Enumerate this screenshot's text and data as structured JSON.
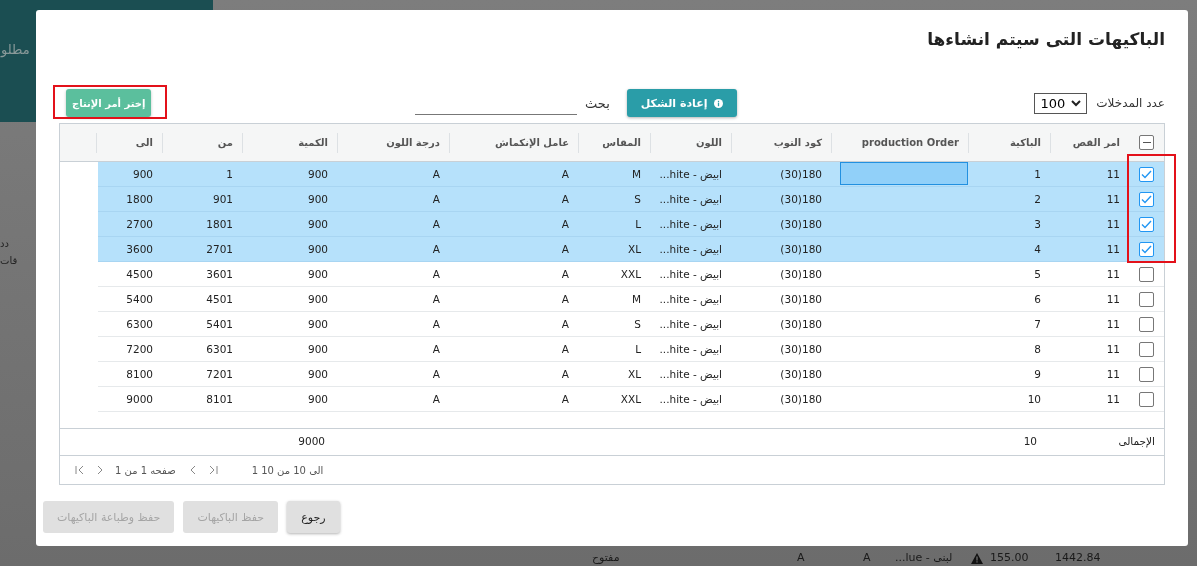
{
  "background": {
    "header_subtitle": "مطلو",
    "side_labels": [
      "دد",
      "قات"
    ],
    "row_cells": [
      "1442.84",
      "155.00",
      "...lue - لبنى",
      "A",
      "A",
      "مفتوح"
    ],
    "row_warning": true
  },
  "dialog": {
    "title": "الباكيهات التى سيتم انشاءها",
    "entries_label": "عدد المدخلات",
    "entries_value": "100",
    "reset_button": "إعادة الشكل",
    "search_label": "بحث",
    "choose_button": "إختر أمر الإنتاج",
    "header_checkbox_partial": true,
    "columns": [
      "امر القص",
      "الباكية",
      "production Order",
      "كود التوب",
      "اللون",
      "المقاس",
      "عامل الإنكماش",
      "درجة اللون",
      "الكمية",
      "من",
      "الى"
    ],
    "rows": [
      {
        "selected": true,
        "editing": true,
        "cells": [
          "11",
          "1",
          "",
          "180(30)",
          "ابيض - hite...",
          "M",
          "A",
          "A",
          "900",
          "1",
          "900"
        ]
      },
      {
        "selected": true,
        "editing": false,
        "cells": [
          "11",
          "2",
          "",
          "180(30)",
          "ابيض - hite...",
          "S",
          "A",
          "A",
          "900",
          "901",
          "1800"
        ]
      },
      {
        "selected": true,
        "editing": false,
        "cells": [
          "11",
          "3",
          "",
          "180(30)",
          "ابيض - hite...",
          "L",
          "A",
          "A",
          "900",
          "1801",
          "2700"
        ]
      },
      {
        "selected": true,
        "editing": false,
        "cells": [
          "11",
          "4",
          "",
          "180(30)",
          "ابيض - hite...",
          "XL",
          "A",
          "A",
          "900",
          "2701",
          "3600"
        ]
      },
      {
        "selected": false,
        "editing": false,
        "cells": [
          "11",
          "5",
          "",
          "180(30)",
          "ابيض - hite...",
          "XXL",
          "A",
          "A",
          "900",
          "3601",
          "4500"
        ]
      },
      {
        "selected": false,
        "editing": false,
        "cells": [
          "11",
          "6",
          "",
          "180(30)",
          "ابيض - hite...",
          "M",
          "A",
          "A",
          "900",
          "4501",
          "5400"
        ]
      },
      {
        "selected": false,
        "editing": false,
        "cells": [
          "11",
          "7",
          "",
          "180(30)",
          "ابيض - hite...",
          "S",
          "A",
          "A",
          "900",
          "5401",
          "6300"
        ]
      },
      {
        "selected": false,
        "editing": false,
        "cells": [
          "11",
          "8",
          "",
          "180(30)",
          "ابيض - hite...",
          "L",
          "A",
          "A",
          "900",
          "6301",
          "7200"
        ]
      },
      {
        "selected": false,
        "editing": false,
        "cells": [
          "11",
          "9",
          "",
          "180(30)",
          "ابيض - hite...",
          "XL",
          "A",
          "A",
          "900",
          "7201",
          "8100"
        ]
      },
      {
        "selected": false,
        "editing": false,
        "cells": [
          "11",
          "10",
          "",
          "180(30)",
          "ابيض - hite...",
          "XXL",
          "A",
          "A",
          "900",
          "8101",
          "9000"
        ]
      }
    ],
    "totals": {
      "label": "الإجمالى",
      "count": "10",
      "quantity": "9000"
    },
    "pager": {
      "range": "1 الى 10 من 10",
      "page": "صفحه 1 من 1"
    },
    "buttons": [
      {
        "label": "رجوع",
        "disabled": false
      },
      {
        "label": "حفظ الباكيهات",
        "disabled": true
      },
      {
        "label": "حفظ وطباعة الباكيهات",
        "disabled": true
      }
    ]
  }
}
